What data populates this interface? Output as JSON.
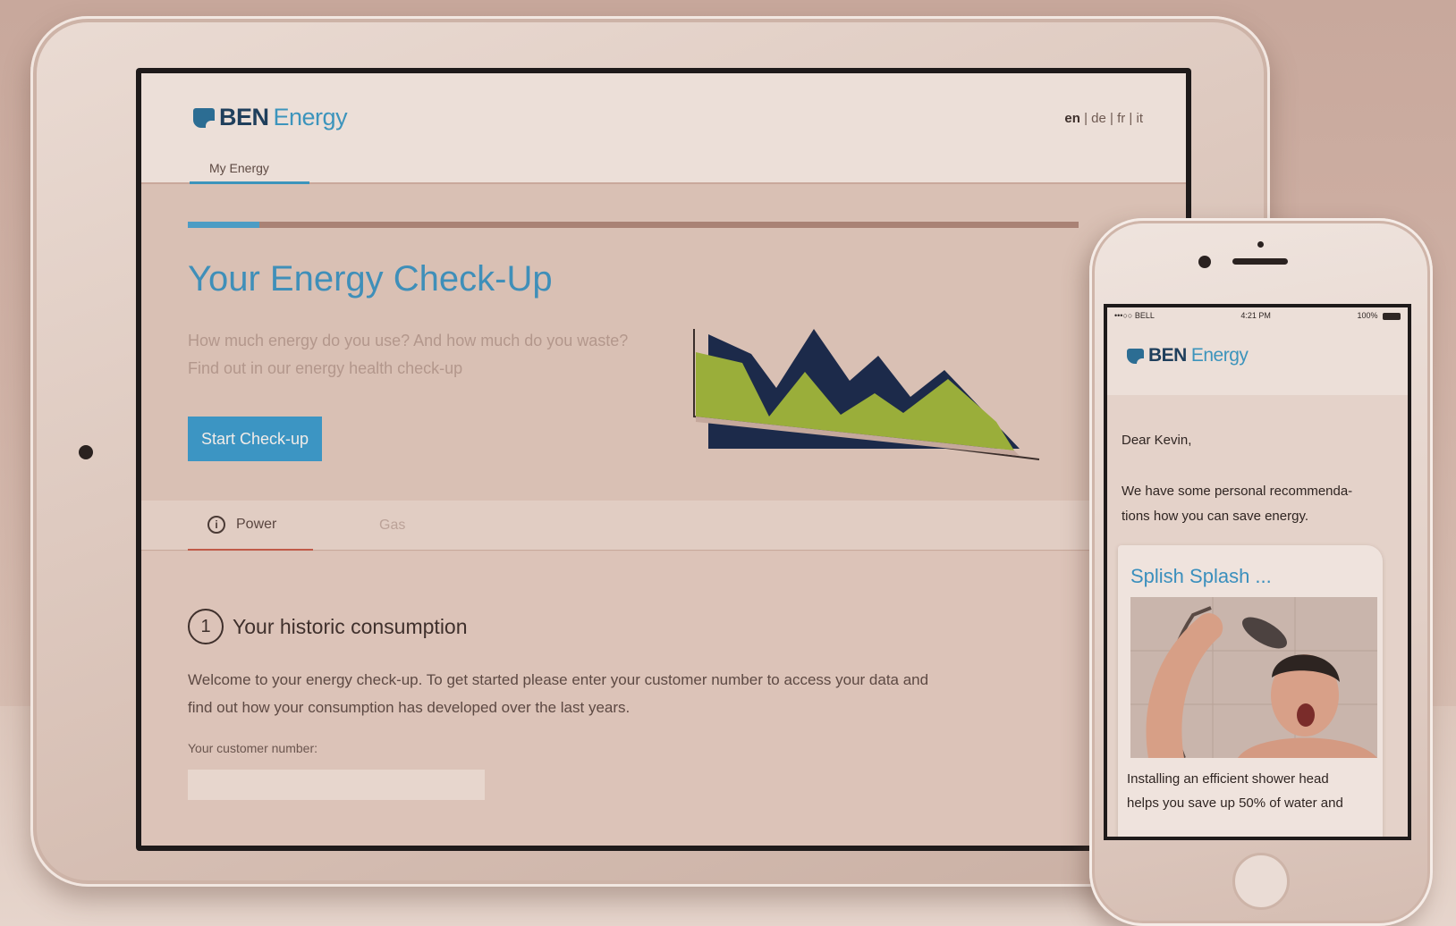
{
  "tablet": {
    "logo": {
      "bold": "BEN",
      "light": "Energy"
    },
    "languages": [
      "en",
      "de",
      "fr",
      "it"
    ],
    "nav_tab": "My Energy",
    "progress": 0.08,
    "hero": {
      "title": "Your Energy Check-Up",
      "subtitle_line1": "How much energy do you use? And how much do you waste?",
      "subtitle_line2": "Find out in our energy health check-up",
      "button": "Start Check-up"
    },
    "tabs": {
      "power": "Power",
      "gas": "Gas"
    },
    "step": {
      "number": "1",
      "title": "Your historic consumption",
      "desc_line1": "Welcome to your energy check-up. To get started please enter your customer number to access your data and",
      "desc_line2": "find out how your consumption has developed over the last years.",
      "field_label": "Your customer number:",
      "field_value": ""
    },
    "icons": {
      "info": "info-icon",
      "settings": "gear-icon"
    },
    "colors": {
      "accent": "#3c94bc",
      "brand_dark": "#1f3f5c",
      "chart_navy": "#1c2a4a",
      "chart_green": "#9aae3a"
    }
  },
  "phone": {
    "status": {
      "carrier": "•••○○ BELL",
      "time": "4:21 PM",
      "battery": "100%"
    },
    "logo": {
      "bold": "BEN",
      "light": "Energy"
    },
    "greeting": "Dear Kevin,",
    "intro_line1": "We have some personal recommenda-",
    "intro_line2": "tions how you can save energy.",
    "tip": {
      "title": "Splish Splash ...",
      "line1": "Installing an efficient shower head",
      "line2": "helps you save up 50% of water and"
    }
  }
}
